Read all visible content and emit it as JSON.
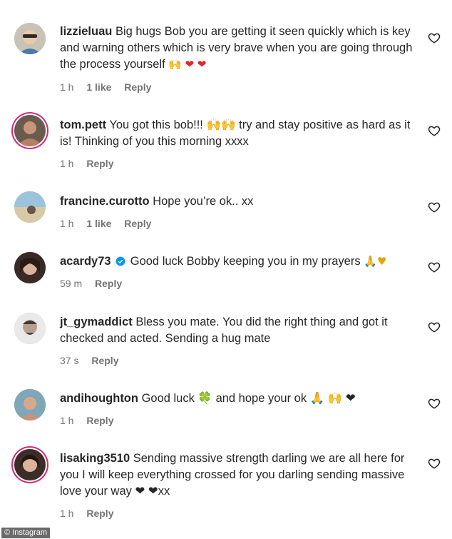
{
  "comments": [
    {
      "username": "lizzieluau",
      "text": "Big hugs Bob you are getting it seen quickly which is key and warning others which is very brave when you are going through the process yourself",
      "emoji": "🙌 ❤ ❤",
      "time": "1 h",
      "likes": "1 like",
      "reply": "Reply"
    },
    {
      "username": "tom.pett",
      "text": "You got this bob!!! 🙌🙌 try and stay positive as hard as it is! Thinking of you this morning xxxx",
      "emoji": "",
      "time": "1 h",
      "likes": "",
      "reply": "Reply"
    },
    {
      "username": "francine.curotto",
      "text": "Hope you’re ok.. xx",
      "emoji": "",
      "time": "1 h",
      "likes": "1 like",
      "reply": "Reply"
    },
    {
      "username": "acardy73",
      "text": "Good luck Bobby keeping you in my prayers",
      "emoji": "🙏♥",
      "time": "59 m",
      "likes": "",
      "reply": "Reply"
    },
    {
      "username": "jt_gymaddict",
      "text": "Bless you mate. You did the right thing and got it checked and acted. Sending a hug mate",
      "emoji": "",
      "time": "37 s",
      "likes": "",
      "reply": "Reply"
    },
    {
      "username": "andihoughton",
      "text": "Good luck 🍀 and hope your ok 🙏 🙌 ❤",
      "emoji": "",
      "time": "1 h",
      "likes": "",
      "reply": "Reply"
    },
    {
      "username": "lisaking3510",
      "text": "Sending massive strength darling we are all here for you I will keep everything crossed for you darling sending massive love your way ❤ ❤xx",
      "emoji": "",
      "time": "1 h",
      "likes": "",
      "reply": "Reply"
    }
  ],
  "watermark": "© Instagram",
  "colors": {
    "text": "#262626",
    "meta": "#737373",
    "story_ring": "#d62976",
    "verified": "#0095f6"
  }
}
